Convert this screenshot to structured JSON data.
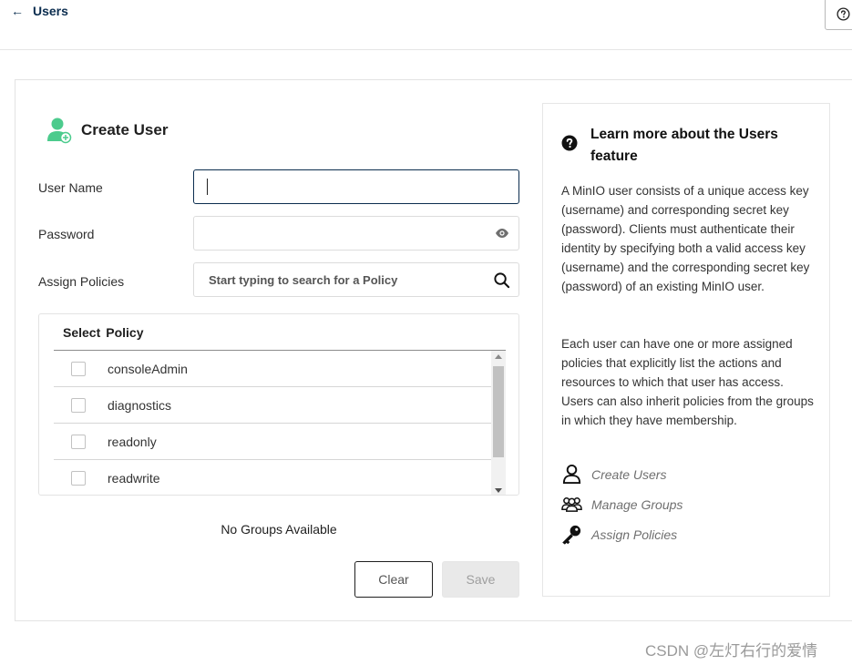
{
  "header": {
    "back_arrow": "←",
    "title": "Users",
    "help_icon": "question-circle-icon"
  },
  "form": {
    "title": "Create User",
    "title_icon": "user-add-icon",
    "username_label": "User Name",
    "username_value": "",
    "password_label": "Password",
    "password_value": "",
    "policies_label": "Assign Policies",
    "policies_placeholder": "Start typing to search for a Policy",
    "policy_table": {
      "headers": [
        "Select",
        "Policy"
      ],
      "rows": [
        {
          "name": "consoleAdmin",
          "checked": false
        },
        {
          "name": "diagnostics",
          "checked": false
        },
        {
          "name": "readonly",
          "checked": false
        },
        {
          "name": "readwrite",
          "checked": false
        }
      ]
    },
    "groups_message": "No Groups Available",
    "clear_label": "Clear",
    "save_label": "Save"
  },
  "help": {
    "title": "Learn more about the Users feature",
    "paragraph1": "A MinIO user consists of a unique access key (username) and corresponding secret key (password). Clients must authenticate their identity by specifying both a valid access key (username) and the corresponding secret key (password) of an existing MinIO user.",
    "paragraph2": "Each user can have one or more assigned policies that explicitly list the actions and resources to which that user has access. Users can also inherit policies from the groups in which they have membership.",
    "links": [
      {
        "label": "Create Users",
        "icon": "user-icon"
      },
      {
        "label": "Manage Groups",
        "icon": "users-group-icon"
      },
      {
        "label": "Assign Policies",
        "icon": "key-icon"
      }
    ]
  },
  "watermark": "CSDN @左灯右行的爱情",
  "colors": {
    "brand_navy": "#0b2d4f",
    "accent_green": "#4ccb8d",
    "save_disabled": "#e9e9e9"
  }
}
